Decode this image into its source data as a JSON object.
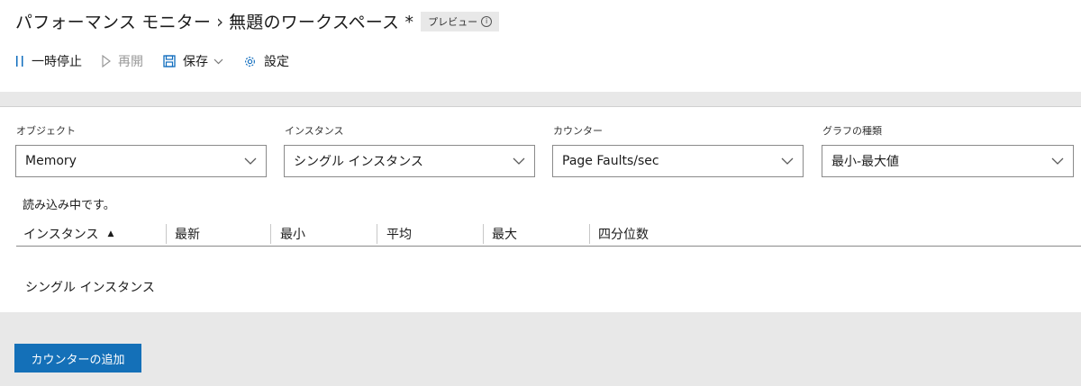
{
  "header": {
    "breadcrumb_root": "パフォーマンス モニター",
    "breadcrumb_sep": "›",
    "workspace_title": "無題のワークスペース *",
    "preview_label": "プレビュー"
  },
  "toolbar": {
    "pause_label": "一時停止",
    "resume_label": "再開",
    "save_label": "保存",
    "settings_label": "設定"
  },
  "filters": {
    "object": {
      "label": "オブジェクト",
      "value": "Memory"
    },
    "instance": {
      "label": "インスタンス",
      "value": "シングル インスタンス"
    },
    "counter": {
      "label": "カウンター",
      "value": "Page Faults/sec"
    },
    "graph_type": {
      "label": "グラフの種類",
      "value": "最小-最大値"
    }
  },
  "status": {
    "loading_text": "読み込み中です。"
  },
  "table": {
    "columns": [
      "インスタンス",
      "最新",
      "最小",
      "平均",
      "最大",
      "四分位数"
    ],
    "rows": [
      [
        "シングル インスタンス",
        "",
        "",
        "",
        "",
        ""
      ]
    ]
  },
  "actions": {
    "add_counter_label": "カウンターの追加"
  },
  "colors": {
    "accent": "#1470b8",
    "band": "#e8e8e8"
  }
}
